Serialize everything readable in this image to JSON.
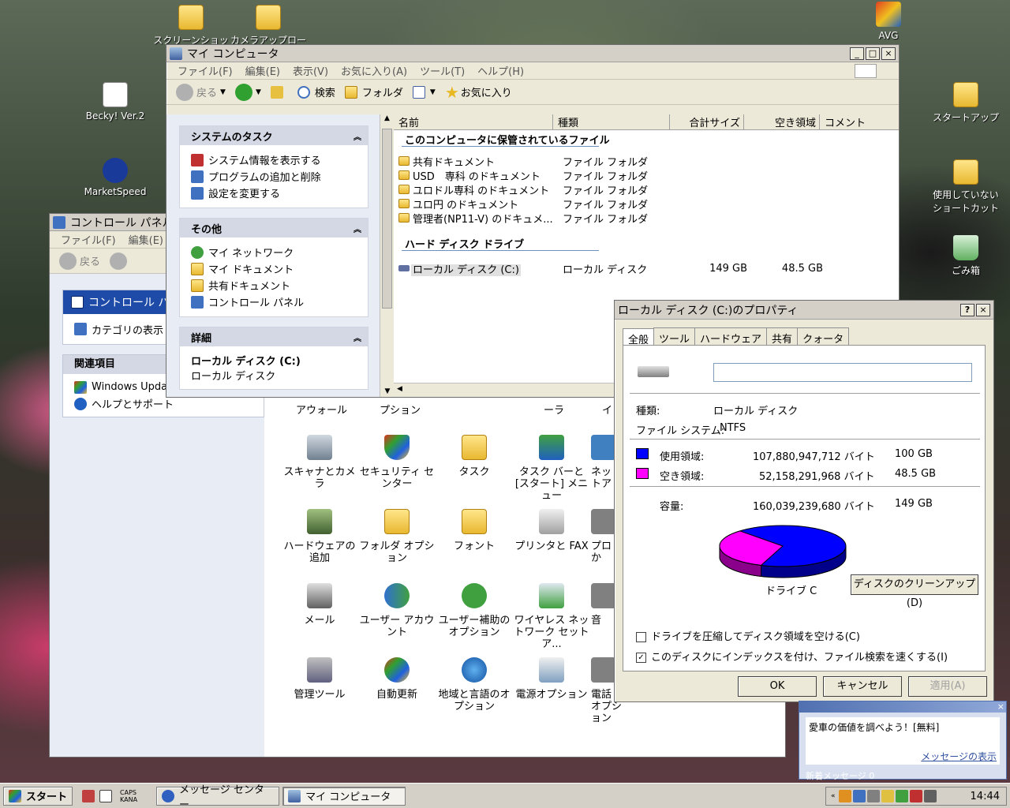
{
  "desktop": {
    "icons": [
      {
        "label": "スクリーンショット"
      },
      {
        "label": "カメラアップロー"
      },
      {
        "label": "AVG"
      },
      {
        "label": "Becky! Ver.2"
      },
      {
        "label": "MarketSpeed"
      },
      {
        "label": "スタートアップ"
      },
      {
        "label": "使用していない ショートカット"
      },
      {
        "label": "ごみ箱"
      }
    ]
  },
  "explorer": {
    "title": "マイ コンピュータ",
    "menu": [
      "ファイル(F)",
      "編集(E)",
      "表示(V)",
      "お気に入り(A)",
      "ツール(T)",
      "ヘルプ(H)"
    ],
    "toolbar": {
      "back": "戻る",
      "search": "検索",
      "folders": "フォルダ",
      "favorites": "お気に入り"
    },
    "tasks": {
      "system_title": "システムのタスク",
      "system_items": [
        "システム情報を表示する",
        "プログラムの追加と削除",
        "設定を変更する"
      ],
      "other_title": "その他",
      "other_items": [
        "マイ ネットワーク",
        "マイ ドキュメント",
        "共有ドキュメント",
        "コントロール パネル"
      ],
      "details_title": "詳細",
      "details_name": "ローカル ディスク (C:)",
      "details_type": "ローカル ディスク"
    },
    "columns": [
      "名前",
      "種類",
      "合計サイズ",
      "空き領域",
      "コメント"
    ],
    "section_files": "このコンピュータに保管されているファイル",
    "files": [
      {
        "name": "共有ドキュメント",
        "type": "ファイル フォルダ"
      },
      {
        "name": "USD　専科 のドキュメント",
        "type": "ファイル フォルダ"
      },
      {
        "name": "ユロドル専科 のドキュメント",
        "type": "ファイル フォルダ"
      },
      {
        "name": "ユロ円 のドキュメント",
        "type": "ファイル フォルダ"
      },
      {
        "name": "管理者(NP11-V) のドキュメ...",
        "type": "ファイル フォルダ"
      }
    ],
    "section_drives": "ハード ディスク ドライブ",
    "drive": {
      "name": "ローカル ディスク (C:)",
      "type": "ローカル ディスク",
      "total": "149 GB",
      "free": "48.5 GB"
    }
  },
  "control_panel": {
    "title": "コントロール パネル",
    "menu": [
      "ファイル(F)",
      "編集(E)"
    ],
    "back": "戻る",
    "header": "コントロール パ",
    "category_view": "カテゴリの表示",
    "related_title": "関連項目",
    "related_items": [
      "Windows Update",
      "ヘルプとサポート"
    ],
    "partial_labels": [
      "アウォール",
      "プション",
      "ーラ",
      "イ"
    ],
    "icons": [
      {
        "label": "スキャナとカメラ"
      },
      {
        "label": "セキュリティ センター"
      },
      {
        "label": "タスク"
      },
      {
        "label": "タスク バーと [スタート] メニュー"
      },
      {
        "label": "ネット トア"
      },
      {
        "label": "ハードウェアの追加"
      },
      {
        "label": "フォルダ オプション"
      },
      {
        "label": "フォント"
      },
      {
        "label": "プリンタと FAX"
      },
      {
        "label": "プロ か"
      },
      {
        "label": "メール"
      },
      {
        "label": "ユーザー アカウント"
      },
      {
        "label": "ユーザー補助のオプション"
      },
      {
        "label": "ワイヤレス ネットワーク セットア..."
      },
      {
        "label": "音"
      },
      {
        "label": "管理ツール"
      },
      {
        "label": "自動更新"
      },
      {
        "label": "地域と言語のオプション"
      },
      {
        "label": "電源オプション"
      },
      {
        "label": "電話 オプション"
      }
    ]
  },
  "properties": {
    "title": "ローカル ディスク (C:)のプロパティ",
    "tabs": [
      "全般",
      "ツール",
      "ハードウェア",
      "共有",
      "クォータ"
    ],
    "name_value": "",
    "type_label": "種類:",
    "type_value": "ローカル ディスク",
    "fs_label": "ファイル システム:",
    "fs_value": "NTFS",
    "used_label": "使用領域:",
    "used_bytes": "107,880,947,712 バイト",
    "used_gb": "100 GB",
    "free_label": "空き領域:",
    "free_bytes": "52,158,291,968 バイト",
    "free_gb": "48.5 GB",
    "cap_label": "容量:",
    "cap_bytes": "160,039,239,680 バイト",
    "cap_gb": "149 GB",
    "used_color": "#0000ff",
    "free_color": "#ff00ff",
    "used_fraction": 0.674,
    "drive_label": "ドライブ C",
    "cleanup": "ディスクのクリーンアップ(D)",
    "compress": "ドライブを圧縮してディスク領域を空ける(C)",
    "index": "このディスクにインデックスを付け、ファイル検索を速くする(I)",
    "compress_checked": false,
    "index_checked": true,
    "ok": "OK",
    "cancel": "キャンセル",
    "apply": "適用(A)"
  },
  "messenger_popup": {
    "text": "愛車の価値を調べよう！[無料]",
    "link": "メッセージの表示",
    "footer": "新着メッセージ 0"
  },
  "taskbar": {
    "start": "スタート",
    "caps": "CAPS",
    "kana": "KANA",
    "tasks": [
      "メッセージ センター",
      "マイ コンピュータ"
    ],
    "clock": "14:44"
  }
}
